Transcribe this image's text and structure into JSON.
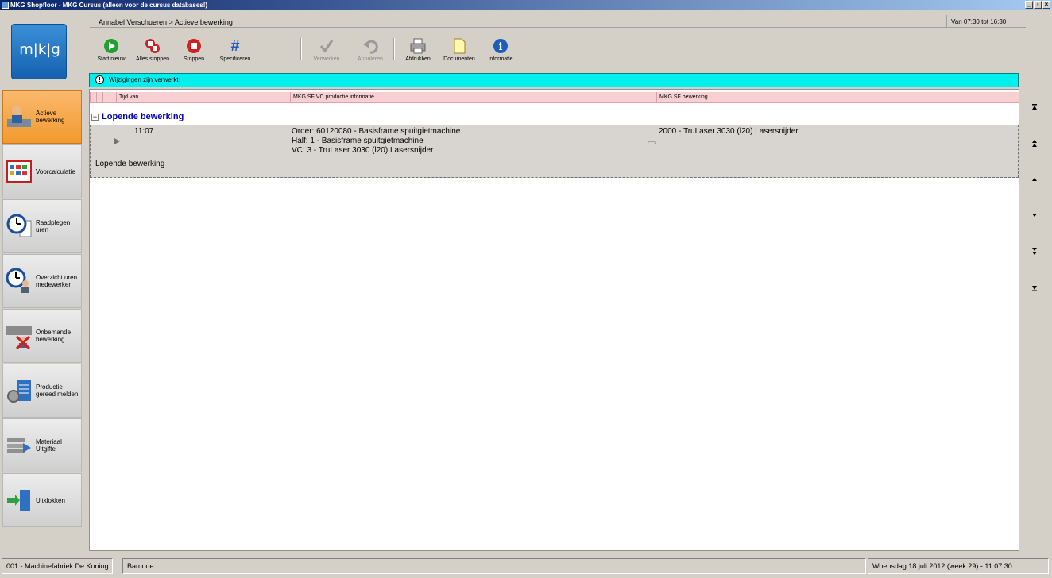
{
  "window": {
    "title": "MKG Shopfloor - MKG Cursus (alleen voor de cursus databases!)"
  },
  "logo": {
    "text": "m|k|g"
  },
  "sidebar": {
    "items": [
      {
        "label": "Actieve bewerking",
        "icon": "worker-machine-icon",
        "active": true
      },
      {
        "label": "Voorcalculatie",
        "icon": "calendar-grid-icon",
        "active": false
      },
      {
        "label": "Raadplegen uren",
        "icon": "clock-document-icon",
        "active": false
      },
      {
        "label": "Overzicht uren medewerker",
        "icon": "clock-person-icon",
        "active": false
      },
      {
        "label": "Onbemande bewerking",
        "icon": "unmanned-machine-icon",
        "active": false
      },
      {
        "label": "Productie gereed melden",
        "icon": "gear-document-icon",
        "active": false
      },
      {
        "label": "Materiaal Uitgifte",
        "icon": "material-stack-icon",
        "active": false
      },
      {
        "label": "Uitklokken",
        "icon": "exit-door-icon",
        "active": false
      }
    ]
  },
  "header": {
    "breadcrumb": "Annabel Verschueren > Actieve bewerking",
    "time_range": "Van 07:30 tot 16:30"
  },
  "toolbar": {
    "start_new": "Start nieuw",
    "stop_all": "Alles stoppen",
    "stop": "Stoppen",
    "specify": "Specificeren",
    "process": "Verwerken",
    "cancel": "Annuleren",
    "print": "Afdrukken",
    "documents": "Documenten",
    "info": "Informatie"
  },
  "notification": {
    "text": "Wijzigingen zijn verwerkt"
  },
  "grid": {
    "columns": [
      "Tijd van",
      "MKG SF VC productie informatie",
      "MKG SF bewerking"
    ],
    "group_label": "Lopende bewerking",
    "row": {
      "time": "11:07",
      "info_line1": "Order: 60120080 - Basisframe spuitgietmachine",
      "info_line2": "Half: 1 - Basisframe spuitgietmachine",
      "info_line3": "VC: 3 - TruLaser 3030 (l20) Lasersnijder",
      "operation": "2000 - TruLaser 3030 (l20) Lasersnijder",
      "footer": "Lopende bewerking"
    }
  },
  "statusbar": {
    "company": "001 - Machinefabriek De Koning",
    "barcode_label": "Barcode :",
    "datetime": "Woensdag 18 juli 2012 (week 29)  - 11:07:30"
  }
}
